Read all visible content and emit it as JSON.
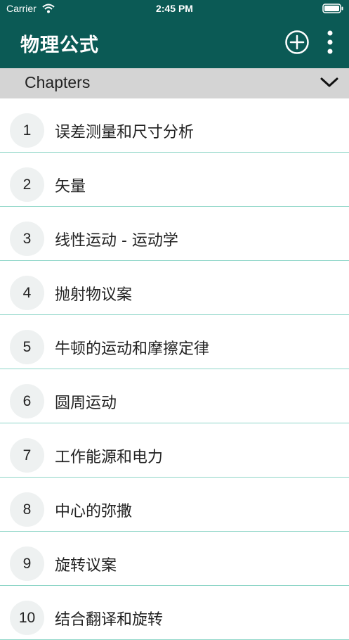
{
  "status_bar": {
    "carrier": "Carrier",
    "time": "2:45 PM",
    "wifi_icon": "wifi-icon",
    "battery_icon": "battery-icon"
  },
  "app_bar": {
    "title": "物理公式",
    "add_icon": "plus-circle-icon",
    "more_icon": "more-vertical-icon",
    "color": "#0b5a55"
  },
  "chapters_header": {
    "label": "Chapters",
    "icon": "chevron-down-icon"
  },
  "chapters": [
    {
      "number": "1",
      "title": "误差测量和尺寸分析"
    },
    {
      "number": "2",
      "title": "矢量"
    },
    {
      "number": "3",
      "title": "线性运动 - 运动学"
    },
    {
      "number": "4",
      "title": "抛射物议案"
    },
    {
      "number": "5",
      "title": "牛顿的运动和摩擦定律"
    },
    {
      "number": "6",
      "title": "圆周运动"
    },
    {
      "number": "7",
      "title": "工作能源和电力"
    },
    {
      "number": "8",
      "title": "中心的弥撒"
    },
    {
      "number": "9",
      "title": "旋转议案"
    },
    {
      "number": "10",
      "title": "结合翻译和旋转"
    }
  ]
}
